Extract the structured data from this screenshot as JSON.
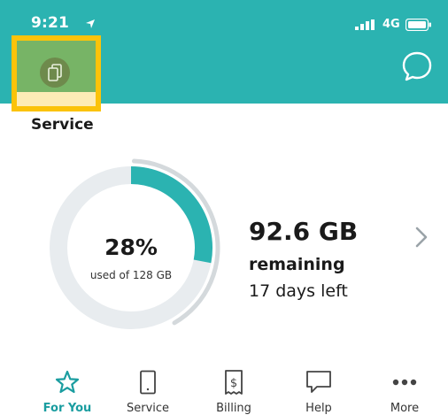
{
  "status_bar": {
    "time": "9:21",
    "network": "4G"
  },
  "header": {
    "service_label": "Service"
  },
  "usage": {
    "percent_text": "28%",
    "used_text": "used of 128 GB",
    "percent_used": 28,
    "remaining_amount": "92.6 GB",
    "remaining_label": "remaining",
    "days_left": "17 days left"
  },
  "tabs": [
    {
      "label": "For You",
      "icon": "star-icon",
      "active": true
    },
    {
      "label": "Service",
      "icon": "phone-icon",
      "active": false
    },
    {
      "label": "Billing",
      "icon": "bill-icon",
      "active": false
    },
    {
      "label": "Help",
      "icon": "chat-bubble-icon",
      "active": false
    },
    {
      "label": "More",
      "icon": "more-icon",
      "active": false
    }
  ],
  "colors": {
    "header": "#2bb3b1",
    "accent": "#1a9da0",
    "ring_track": "#e8ecef",
    "highlight": "#fbc30a"
  }
}
